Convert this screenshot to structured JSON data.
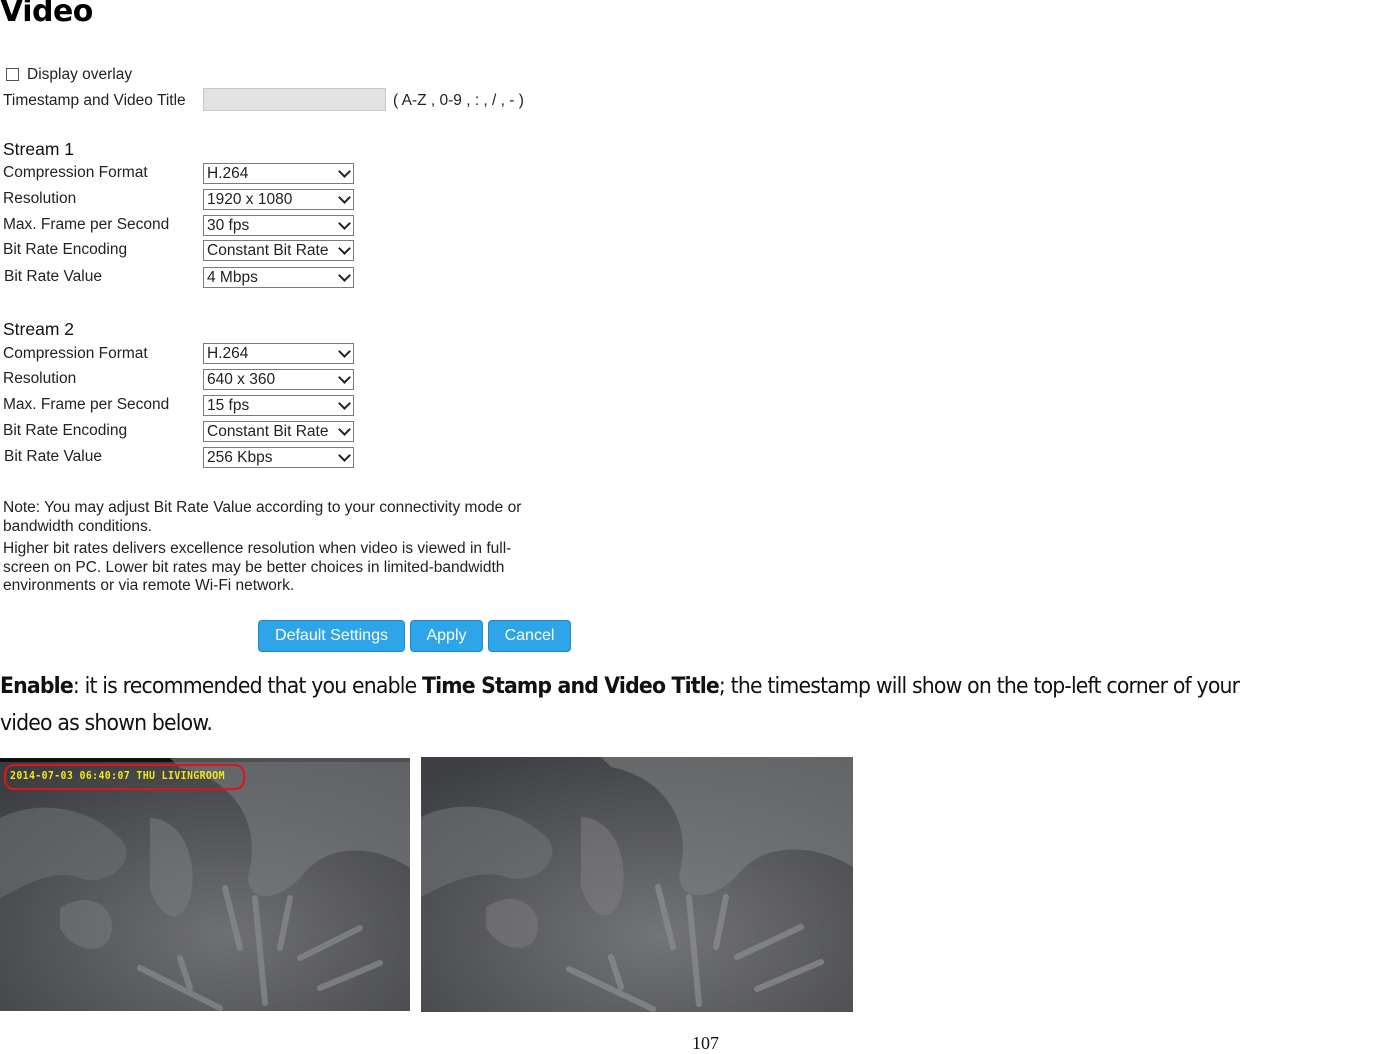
{
  "heading": "Video",
  "overlay": {
    "checkbox_label": "Display overlay",
    "checked": false,
    "title_label": "Timestamp and Video Title",
    "title_value": "",
    "title_hint": "( A-Z , 0-9 , : , / , - )"
  },
  "streams": [
    {
      "title": "Stream 1",
      "fields": [
        {
          "label": "Compression Format",
          "value": "H.264"
        },
        {
          "label": "Resolution",
          "value": "1920 x 1080"
        },
        {
          "label": "Max. Frame per Second",
          "value": "30 fps"
        },
        {
          "label": "Bit Rate Encoding",
          "value": "Constant Bit Rate"
        },
        {
          "label": "Bit Rate Value",
          "value": "4 Mbps"
        }
      ]
    },
    {
      "title": "Stream 2",
      "fields": [
        {
          "label": "Compression Format",
          "value": "H.264"
        },
        {
          "label": "Resolution",
          "value": "640 x 360"
        },
        {
          "label": "Max. Frame per Second",
          "value": "15 fps"
        },
        {
          "label": "Bit Rate Encoding",
          "value": "Constant Bit Rate"
        },
        {
          "label": "Bit Rate Value",
          "value": "256 Kbps"
        }
      ]
    }
  ],
  "notes": {
    "line1a": "Note: You may adjust Bit Rate Value according to your connectivity mode or",
    "line1b": "bandwidth conditions.",
    "line2a": "Higher bit rates delivers excellence resolution when video is viewed in full-",
    "line2b": "screen on PC. Lower bit rates may be better choices in limited-bandwidth",
    "line2c": "environments or via remote Wi-Fi network."
  },
  "buttons": {
    "default": "Default Settings",
    "apply": "Apply",
    "cancel": "Cancel",
    "color": "#2da5e8"
  },
  "paragraph": {
    "b1": "Enable",
    "t1": ": it is recommended that you enable ",
    "b2": "Time Stamp and Video Title",
    "t2": "; the timestamp will show on the top-left corner of your",
    "line2": "video as shown below."
  },
  "images": {
    "left_overlay_text": "2014-07-03 06:40:07 THU  LIVINGROOM",
    "highlight_color": "#e0141b",
    "overlay_text_color": "#f2e61c"
  },
  "page_number": "107"
}
